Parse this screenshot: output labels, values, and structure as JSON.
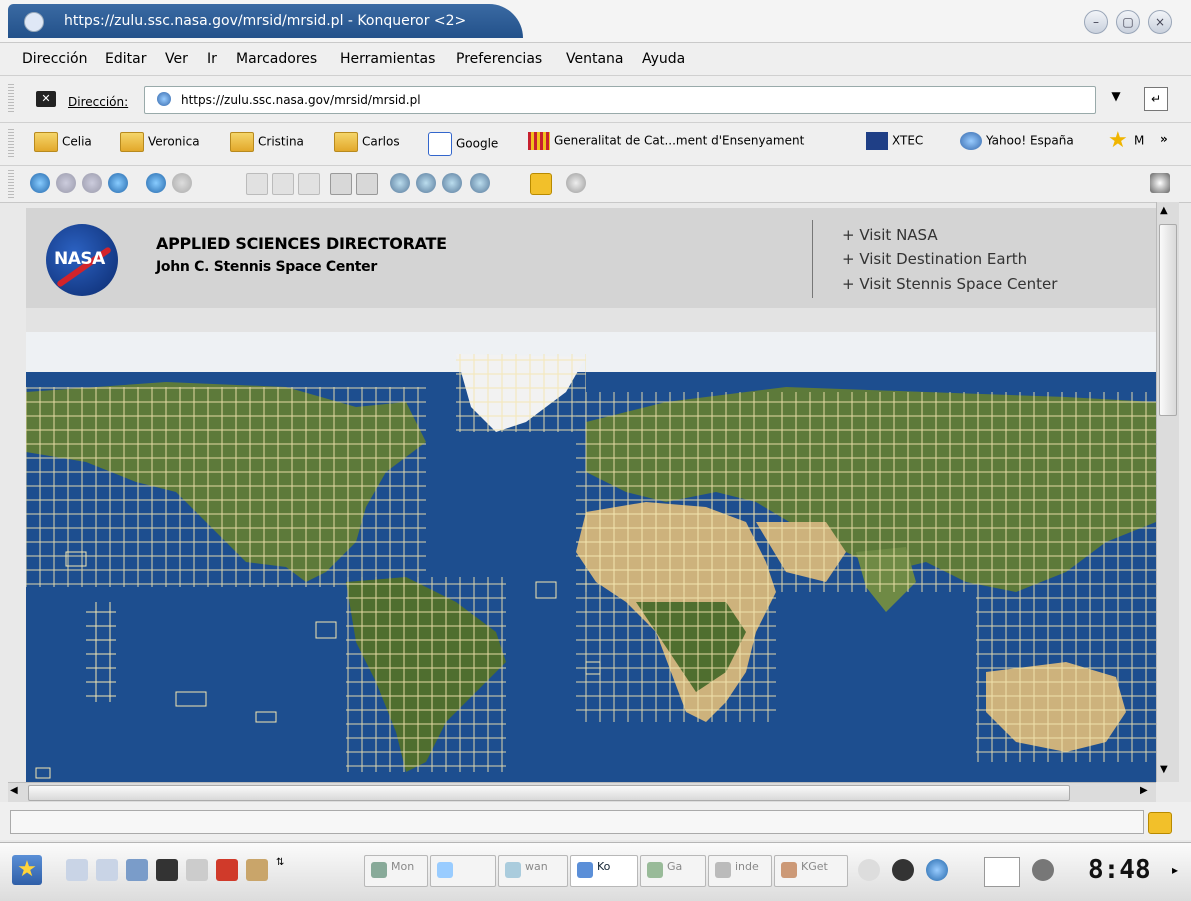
{
  "window": {
    "title": "https://zulu.ssc.nasa.gov/mrsid/mrsid.pl - Konqueror <2>"
  },
  "menu": [
    "Dirección",
    "Editar",
    "Ver",
    "Ir",
    "Marcadores",
    "Herramientas",
    "Preferencias",
    "Ventana",
    "Ayuda"
  ],
  "location": {
    "label": "Dirección:",
    "url": "https://zulu.ssc.nasa.gov/mrsid/mrsid.pl"
  },
  "bookmarks": [
    "Celia",
    "Veronica",
    "Cristina",
    "Carlos",
    "Google",
    "Generalitat de Cat...ment d'Ensenyament",
    "XTEC",
    "Yahoo! España",
    "M",
    "»"
  ],
  "page": {
    "logo_text": "NASA",
    "directorate": "APPLIED SCIENCES DIRECTORATE",
    "center": "John C. Stennis Space Center",
    "links": [
      "+ Visit NASA",
      "+ Visit Destination Earth",
      "+ Visit Stennis Space Center"
    ]
  },
  "taskbar": {
    "tasks": [
      "Mon",
      "",
      "wan",
      "Ko",
      "Ga",
      "inde",
      "KGet"
    ],
    "clock": "8:48"
  },
  "colors": {
    "title_active": "#2b5a96",
    "ocean": "#1d4e8f",
    "land": "#5d7a3a",
    "desert": "#cdb27c",
    "ice": "#f2f2f2",
    "tile_outline": "#f4e6b0",
    "header_band": "#d4d4d4"
  }
}
